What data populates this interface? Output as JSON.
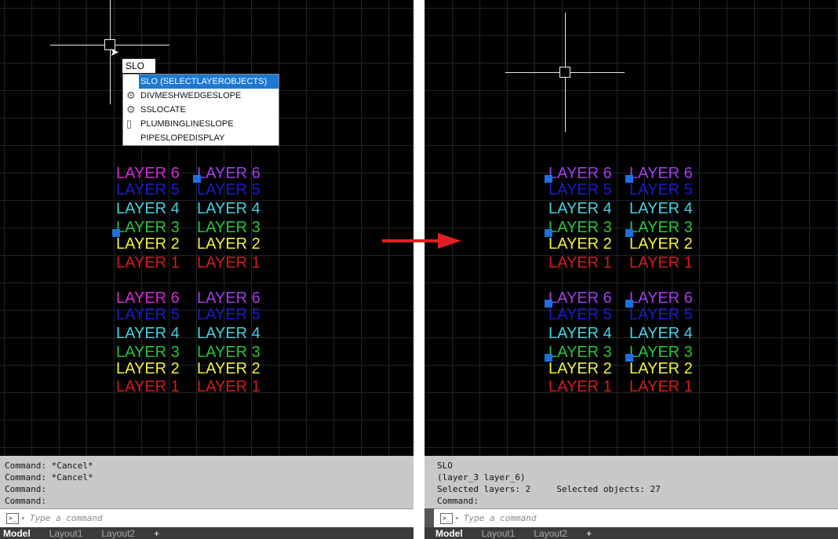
{
  "labels": [
    "LAYER 6",
    "LAYER 5",
    "LAYER 4",
    "LAYER 3",
    "LAYER 2",
    "LAYER 1"
  ],
  "colors": {
    "layer6": "#d22ad2",
    "layer6b": "#a23ee8",
    "layer5": "#1c1cc8",
    "layer4": "#46d2e0",
    "layer3": "#28c43c",
    "layer2": "#f4f040",
    "layer1": "#d41c1c",
    "grip": "#1f6fe0",
    "arrow": "#e02020"
  },
  "left": {
    "autocomplete": {
      "input": "SLO",
      "items": [
        {
          "label": "SLO (SELECTLAYEROBJECTS)",
          "icon": "none",
          "selected": true
        },
        {
          "label": "DIVMESHWEDGESLOPE",
          "icon": "gear-icon"
        },
        {
          "label": "SSLOCATE",
          "icon": "gear-icon"
        },
        {
          "label": "PLUMBINGLINESLOPE",
          "icon": "plumbing-icon"
        },
        {
          "label": "PIPESLOPEDISPLAY",
          "icon": "none"
        }
      ]
    },
    "history": [
      "Command: *Cancel*",
      "Command: *Cancel*",
      "Command:",
      "Command:"
    ],
    "placeholder": "Type a command",
    "tabs": [
      "Model",
      "Layout1",
      "Layout2",
      "+"
    ]
  },
  "right": {
    "history": [
      "SLO",
      "(layer_3 layer_6)",
      "Selected layers: 2     Selected objects: 27",
      "Command:"
    ],
    "placeholder": "Type a command",
    "tabs": [
      "Model",
      "Layout1",
      "Layout2",
      "+"
    ]
  }
}
